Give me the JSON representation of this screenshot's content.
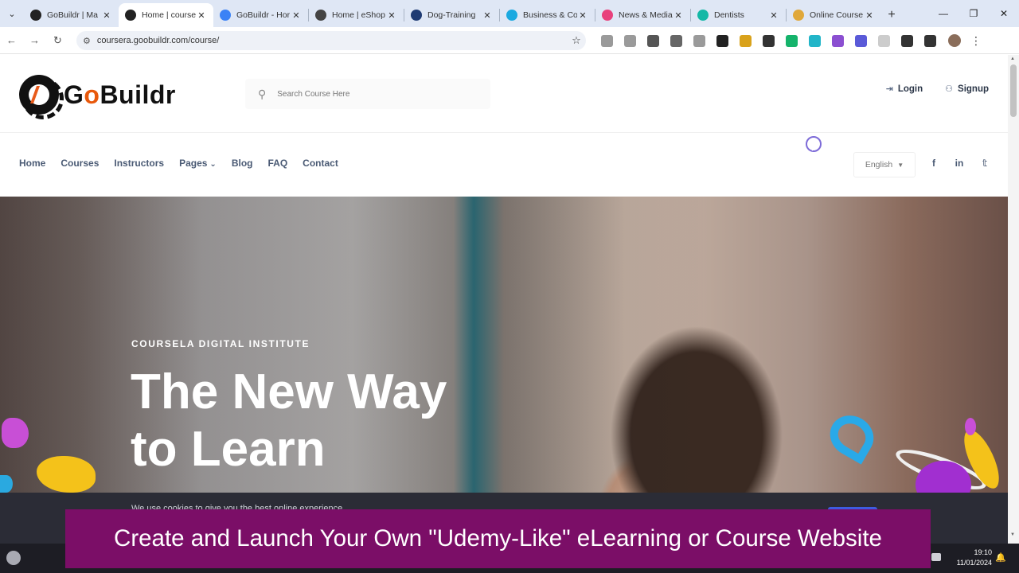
{
  "browser": {
    "tabs": [
      {
        "label": "GoBuildr | Ma",
        "color": "#222222",
        "active": false
      },
      {
        "label": "Home | course",
        "color": "#222222",
        "active": true
      },
      {
        "label": "GoBuildr - Hor",
        "color": "#3b82f6",
        "active": false
      },
      {
        "label": "Home | eShop",
        "color": "#444444",
        "active": false
      },
      {
        "label": "Dog-Training",
        "color": "#1f3b73",
        "active": false
      },
      {
        "label": "Business & Co",
        "color": "#1ba9e0",
        "active": false
      },
      {
        "label": "News & Media",
        "color": "#e8417c",
        "active": false
      },
      {
        "label": "Dentists",
        "color": "#14b8a6",
        "active": false
      },
      {
        "label": "Online Course",
        "color": "#e0a83a",
        "active": false
      }
    ],
    "close_glyph": "✕",
    "new_tab_glyph": "+",
    "url": "coursera.goobuildr.com/course/",
    "window_controls": {
      "minimize": "—",
      "restore": "❐",
      "close": "✕"
    },
    "extension_colors": [
      "#9a9a9a",
      "#9a9a9a",
      "#555555",
      "#666666",
      "#9a9a9a",
      "#222222",
      "#d9a21b",
      "#333333",
      "#15b36b",
      "#22b5c8",
      "#8b4fd1",
      "#5a5ad8",
      "#cccccc",
      "#333333",
      "#333333"
    ]
  },
  "site": {
    "logo": {
      "pre": "G",
      "accent": "o",
      "post": "Buildr",
      "accent_color": "#e8590c"
    },
    "search": {
      "placeholder": "Search Course Here"
    },
    "auth": {
      "login": "Login",
      "signup": "Signup"
    },
    "menu": [
      "Home",
      "Courses",
      "Instructors",
      "Pages",
      "Blog",
      "FAQ",
      "Contact"
    ],
    "menu_caret": "⌄",
    "language": "English",
    "social": [
      "f",
      "in",
      "𝕥"
    ]
  },
  "hero": {
    "kicker": "COURSELA DIGITAL INSTITUTE",
    "title_line1": "The New Way",
    "title_line2": "to Learn"
  },
  "cookie": {
    "text": "We use cookies to give you the best online experience."
  },
  "taskbar": {
    "time": "19:10",
    "date": "11/01/2024"
  },
  "caption": {
    "text": "Create and Launch Your Own \"Udemy-Like\" eLearning or Course Website"
  }
}
